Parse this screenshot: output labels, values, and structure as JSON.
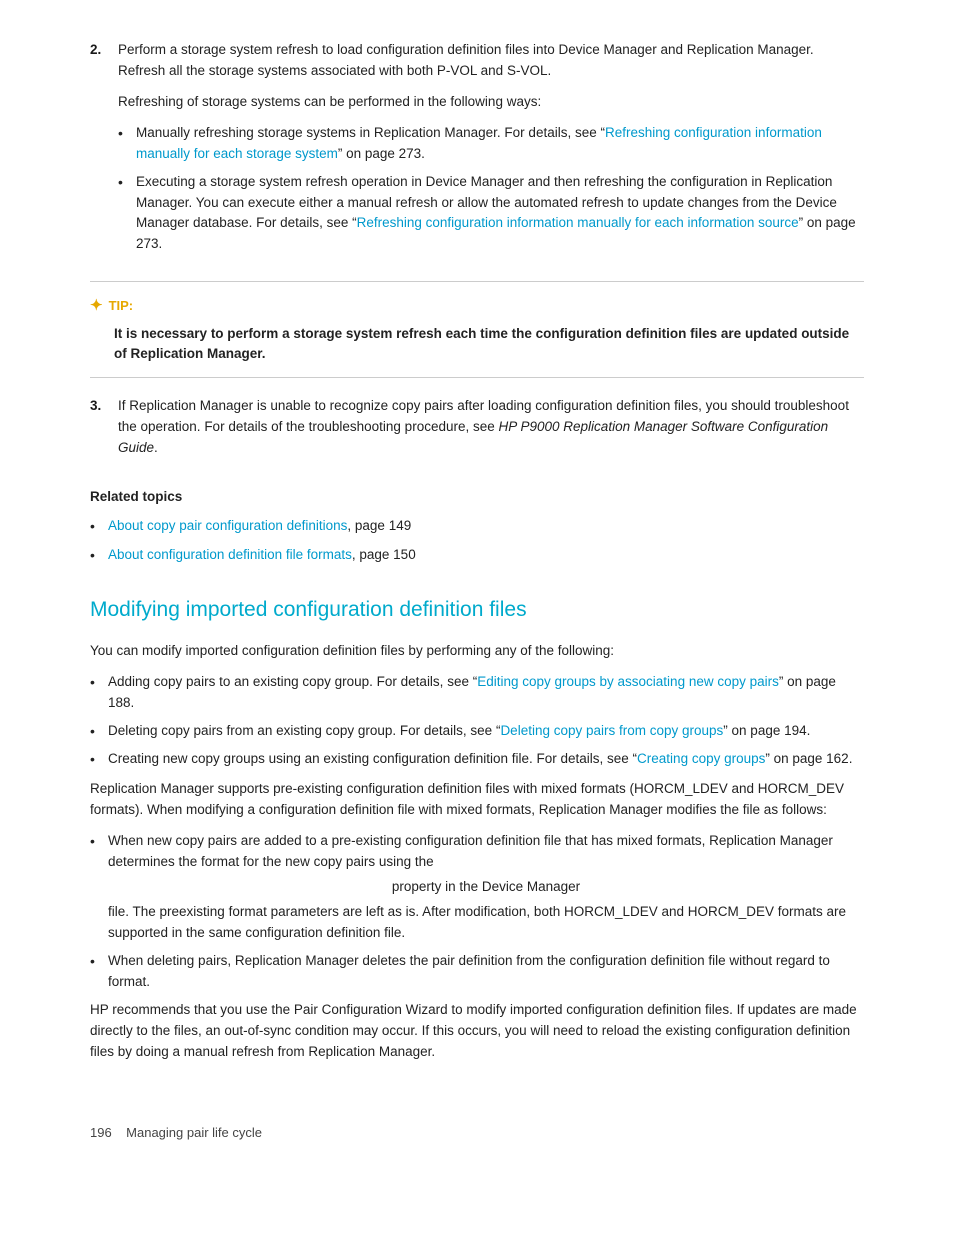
{
  "page": {
    "footer": {
      "page_number": "196",
      "section": "Managing pair life cycle"
    }
  },
  "step2": {
    "number": "2.",
    "main_text": "Perform a storage system refresh to load configuration definition files into Device Manager and Replication Manager. Refresh all the storage systems associated with both P-VOL and S-VOL.",
    "sub_text": "Refreshing of storage systems can be performed in the following ways:",
    "bullets": [
      {
        "before": "Manually refreshing storage systems in Replication Manager. For details, see “",
        "link_text": "Refreshing configuration information manually for each storage system",
        "after": "” on page 273."
      },
      {
        "before": "Executing a storage system refresh operation in Device Manager and then refreshing the configuration in Replication Manager. You can execute either a manual refresh or allow the automated refresh to update changes from the Device Manager database. For details, see “",
        "link_text": "Refreshing configuration information manually for each information source",
        "after": "” on page 273."
      }
    ]
  },
  "tip": {
    "label": "TIP:",
    "content": "It is necessary to perform a storage system refresh each time the configuration definition files are updated outside of Replication Manager."
  },
  "step3": {
    "number": "3.",
    "text_before": "If Replication Manager is unable to recognize copy pairs after loading configuration definition files, you should troubleshoot the operation. For details of the troubleshooting procedure, see ",
    "italic_text": "HP P9000 Replication Manager Software Configuration Guide",
    "text_after": "."
  },
  "related_topics": {
    "header": "Related topics",
    "items": [
      {
        "link_text": "About copy pair configuration definitions",
        "after": ", page 149"
      },
      {
        "link_text": "About configuration definition file formats",
        "after": ", page 150"
      }
    ]
  },
  "section": {
    "heading": "Modifying imported configuration definition files",
    "intro": "You can modify imported configuration definition files by performing any of the following:",
    "bullets": [
      {
        "before": "Adding copy pairs to an existing copy group. For details, see “",
        "link_text": "Editing copy groups by associating new copy pairs",
        "after": "” on page 188."
      },
      {
        "before": "Deleting copy pairs from an existing copy group. For details, see “",
        "link_text": "Deleting copy pairs from copy groups",
        "after": "” on page 194."
      },
      {
        "before": "Creating new copy groups using an existing configuration definition file. For details, see “",
        "link_text": "Creating copy groups",
        "after": "” on page 162."
      }
    ],
    "para1": "Replication Manager supports pre-existing configuration definition files with mixed formats (HORCM_LDEV and HORCM_DEV formats). When modifying a configuration definition file with mixed formats, Replication Manager modifies the file as follows:",
    "mixed_bullets": [
      {
        "text": "When new copy pairs are added to a pre-existing configuration definition file that has mixed formats, Replication Manager determines the format for the new copy pairs using the property in the Device Manager file. The preexisting format parameters are left as is. After modification, both HORCM_LDEV and HORCM_DEV formats are supported in the same configuration definition file."
      },
      {
        "text": "When deleting pairs, Replication Manager deletes the pair definition from the configuration definition file without regard to format."
      }
    ],
    "para2": "HP recommends that you use the Pair Configuration Wizard to modify imported configuration definition files. If updates are made directly to the files, an out-of-sync condition may occur. If this occurs, you will need to reload the existing configuration definition files by doing a manual refresh from Replication Manager."
  }
}
